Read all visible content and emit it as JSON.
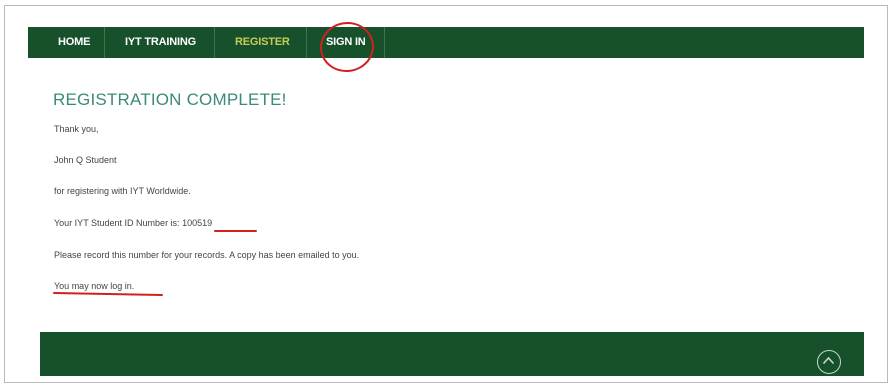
{
  "nav": {
    "items": [
      {
        "label": "HOME"
      },
      {
        "label": "IYT TRAINING"
      },
      {
        "label": "REGISTER"
      },
      {
        "label": "SIGN IN"
      }
    ]
  },
  "main": {
    "title": "REGISTRATION COMPLETE!",
    "thank_you": "Thank you,",
    "student_name": "John Q Student",
    "for_registering": "for registering with IYT Worldwide.",
    "id_prefix": "Your IYT Student ID Number is:",
    "student_id": "100519",
    "record_notice": "Please record this number for your records. A copy has been emailed to you.",
    "login_link": "You may now log in."
  },
  "colors": {
    "nav_bg": "#17512c",
    "active_nav": "#c8cc57",
    "title": "#3b8a7a",
    "annotation": "#d02020"
  },
  "icons": {
    "scroll_top": "chevron-up-circle-icon"
  }
}
